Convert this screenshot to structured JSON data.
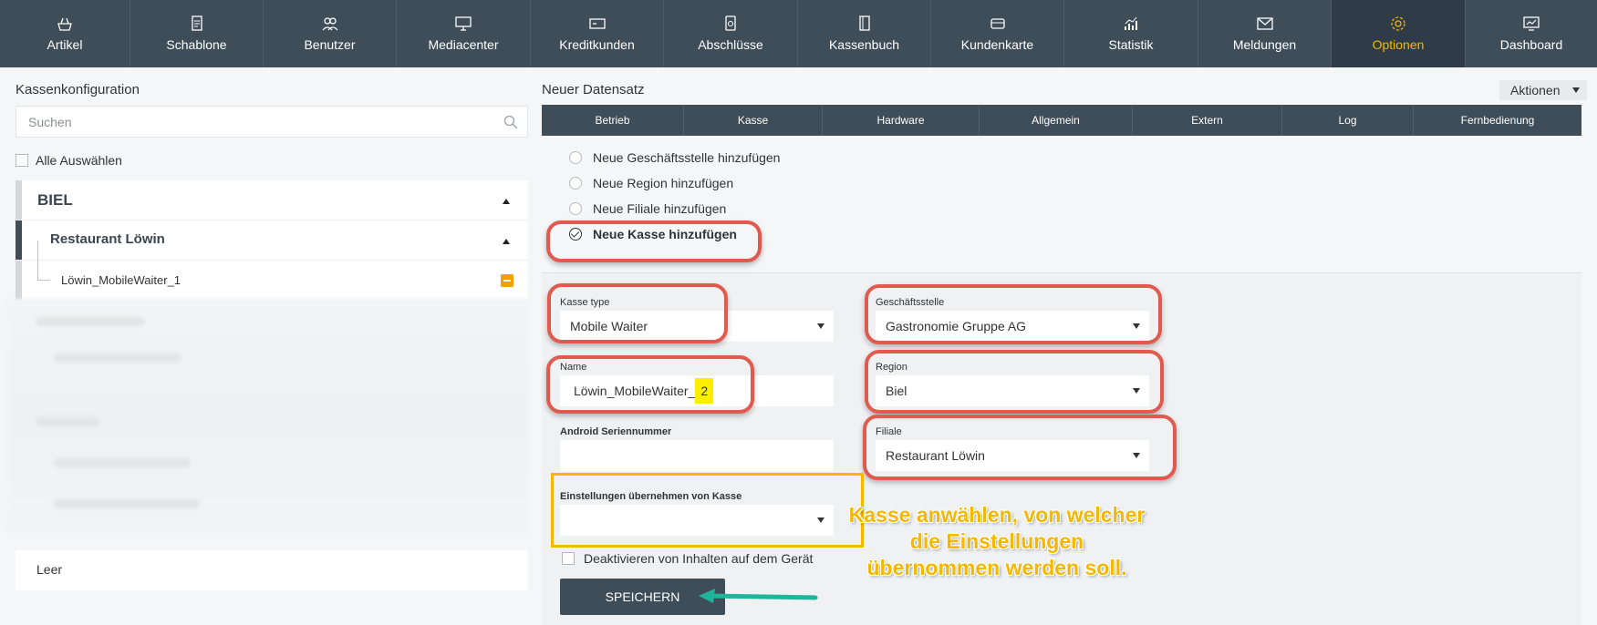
{
  "nav": {
    "items": [
      {
        "label": "Artikel",
        "icon": "basket-icon"
      },
      {
        "label": "Schablone",
        "icon": "document-icon"
      },
      {
        "label": "Benutzer",
        "icon": "users-icon"
      },
      {
        "label": "Mediacenter",
        "icon": "monitor-icon"
      },
      {
        "label": "Kreditkunden",
        "icon": "card-icon"
      },
      {
        "label": "Abschlüsse",
        "icon": "report-icon"
      },
      {
        "label": "Kassenbuch",
        "icon": "book-icon"
      },
      {
        "label": "Kundenkarte",
        "icon": "wallet-icon"
      },
      {
        "label": "Statistik",
        "icon": "chart-icon"
      },
      {
        "label": "Meldungen",
        "icon": "envelope-icon"
      },
      {
        "label": "Optionen",
        "icon": "gear-icon"
      },
      {
        "label": "Dashboard",
        "icon": "dashboard-icon"
      }
    ],
    "active": "Optionen",
    "accent": "#f5b800"
  },
  "left": {
    "title": "Kassenkonfiguration",
    "search_placeholder": "Suchen",
    "select_all": "Alle Auswählen",
    "tree": {
      "region": "BIEL",
      "branch": "Restaurant Löwin",
      "register": "Löwin_MobileWaiter_1"
    },
    "empty_label": "Leer"
  },
  "right": {
    "title": "Neuer Datensatz",
    "actions": "Aktionen",
    "tabs": [
      "Betrieb",
      "Kasse",
      "Hardware",
      "Allgemein",
      "Extern",
      "Log",
      "Fernbedienung"
    ],
    "radios": [
      {
        "label": "Neue Geschäftsstelle hinzufügen",
        "checked": false
      },
      {
        "label": "Neue Region hinzufügen",
        "checked": false
      },
      {
        "label": "Neue Filiale hinzufügen",
        "checked": false
      },
      {
        "label": "Neue Kasse hinzufügen",
        "checked": true
      }
    ],
    "form": {
      "kasse_type_label": "Kasse type",
      "kasse_type_value": "Mobile Waiter",
      "name_label": "Name",
      "name_value_prefix": "Löwin_MobileWaiter_",
      "name_value_highlight": "2",
      "android_label": "Android Seriennummer",
      "android_value": "",
      "einstellungen_label": "Einstellungen übernehmen von Kasse",
      "einstellungen_value": "",
      "deaktivieren_label": "Deaktivieren von Inhalten auf dem Gerät",
      "geschaeftsstelle_label": "Geschäftsstelle",
      "geschaeftsstelle_value": "Gastronomie Gruppe AG",
      "region_label": "Region",
      "region_value": "Biel",
      "filiale_label": "Filiale",
      "filiale_value": "Restaurant Löwin"
    },
    "save": "SPEICHERN"
  },
  "annotation": {
    "callout_lines": [
      "Kasse anwählen, von welcher",
      "die Einstellungen",
      "übernommen werden soll."
    ],
    "oval_color": "#e05a4f",
    "rect_color": "#f5b800",
    "arrow_color": "#1fb59b"
  }
}
